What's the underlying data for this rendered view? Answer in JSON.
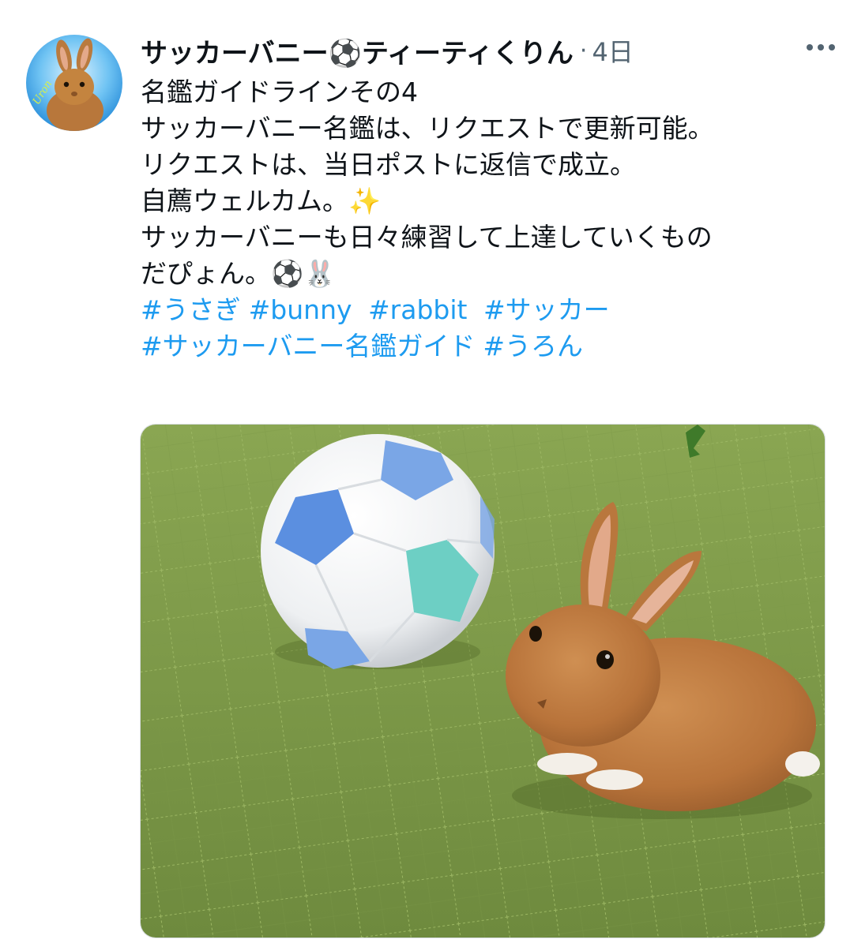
{
  "tweet": {
    "author_name": "サッカーバニー⚽ティーティくりん",
    "separator": "·",
    "timestamp": "4日",
    "lines": [
      "名鑑ガイドラインその4",
      "サッカーバニー名鑑は、リクエストで更新可能。",
      "リクエストは、当日ポストに返信で成立。",
      "自薦ウェルカム。✨",
      "サッカーバニーも日々練習して上達していくもの",
      "だぴょん。⚽🐰"
    ],
    "hashtags_line1": [
      "#うさぎ",
      "#bunny",
      " #rabbit",
      " #サッカー"
    ],
    "hashtags_line2": [
      "#サッカーバニー名鑑ガイド",
      "#うろん"
    ]
  },
  "avatar": {
    "text": "Uron",
    "icon": "rabbit-avatar"
  },
  "media": {
    "icon": "rabbit-with-soccer-ball-photo"
  },
  "colors": {
    "text": "#0f1419",
    "muted": "#536471",
    "link": "#1d9bf0",
    "mat_green": "#7d9a48"
  }
}
